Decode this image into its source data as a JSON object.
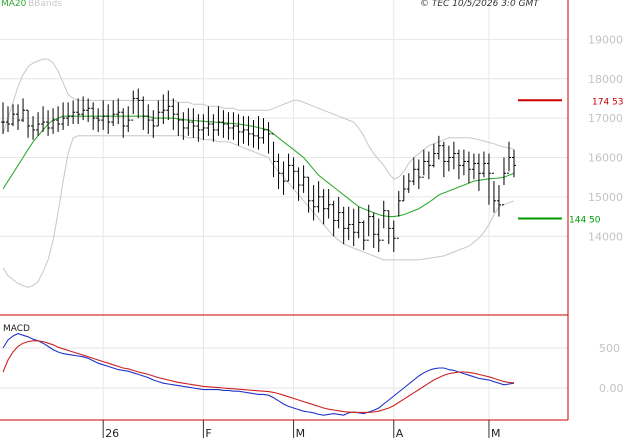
{
  "header": {
    "ma_label": "MA20",
    "bb_label": "BBands",
    "copyright": "© TEC 10/5/2026 3:0 GMT"
  },
  "macd_label": "MACD",
  "colors": {
    "price_bar": "#000000",
    "ma": "#33aa33",
    "bands": "#c8c8c8",
    "resistance": "#cc0000",
    "support": "#009900",
    "macd_line": "#2233cc",
    "signal_line": "#cc2222",
    "grid": "#e6e6e6",
    "axis": "#cc0000"
  },
  "chart_data": [
    {
      "type": "ohlc",
      "title": "",
      "y_ticks": [
        "19000",
        "18000",
        "17000",
        "16000",
        "15000",
        "14000"
      ],
      "ylim": [
        12000,
        20000
      ],
      "x_ticks": [
        "26",
        "F",
        "M",
        "A",
        "M"
      ],
      "resistance": {
        "value": 17453,
        "label": "174 53"
      },
      "support": {
        "value": 14450,
        "label": "144 50"
      },
      "close": [
        16900,
        16850,
        17100,
        16950,
        17200,
        16800,
        16700,
        16850,
        16900,
        16750,
        16950,
        16850,
        17000,
        17050,
        17150,
        17100,
        17200,
        17250,
        17000,
        16950,
        17050,
        16900,
        17100,
        17150,
        16800,
        16950,
        17500,
        17450,
        17050,
        16950,
        16800,
        17150,
        17200,
        17300,
        17100,
        16950,
        16750,
        16900,
        16800,
        16700,
        16750,
        16850,
        16700,
        16900,
        16850,
        16750,
        16800,
        16650,
        16700,
        16600,
        16550,
        16500,
        16700,
        16600,
        15900,
        15600,
        15400,
        15800,
        15650,
        15300,
        15500,
        14900,
        14750,
        15000,
        14700,
        14800,
        14400,
        14600,
        14200,
        14300,
        14100,
        14350,
        13900,
        14500,
        14050,
        13900,
        14650,
        14200,
        13950,
        14900,
        15200,
        15400,
        15700,
        15500,
        15900,
        15800,
        16100,
        16300,
        15900,
        16000,
        16100,
        15800,
        15900,
        15700,
        15850,
        15600,
        15850,
        15600,
        14900,
        14800,
        15600,
        16000,
        15800
      ],
      "high": [
        17400,
        17300,
        17350,
        17350,
        17500,
        17200,
        17050,
        17150,
        17300,
        17200,
        17250,
        17300,
        17400,
        17400,
        17450,
        17500,
        17550,
        17500,
        17400,
        17250,
        17450,
        17350,
        17450,
        17500,
        17250,
        17300,
        17700,
        17750,
        17550,
        17350,
        17200,
        17450,
        17600,
        17700,
        17500,
        17400,
        17150,
        17250,
        17250,
        17100,
        17100,
        17300,
        17100,
        17300,
        17200,
        17150,
        17150,
        17100,
        17050,
        17050,
        16950,
        17050,
        17000,
        16900,
        16400,
        16100,
        15900,
        16100,
        16000,
        15750,
        15800,
        15500,
        15300,
        15400,
        15200,
        15200,
        14900,
        15000,
        14750,
        14750,
        14700,
        14750,
        14400,
        14800,
        14600,
        14450,
        14900,
        14650,
        14400,
        15150,
        15550,
        15600,
        16000,
        15950,
        16200,
        16150,
        16350,
        16550,
        16400,
        16300,
        16400,
        16200,
        16200,
        16150,
        16100,
        16100,
        16150,
        16100,
        15400,
        15300,
        16000,
        16400,
        16200
      ],
      "low": [
        16600,
        16650,
        16800,
        16700,
        16900,
        16500,
        16450,
        16550,
        16650,
        16550,
        16600,
        16650,
        16700,
        16800,
        16850,
        16850,
        16950,
        16900,
        16700,
        16650,
        16700,
        16600,
        16800,
        16850,
        16500,
        16650,
        17100,
        17000,
        16700,
        16600,
        16500,
        16800,
        16850,
        16950,
        16700,
        16550,
        16450,
        16550,
        16500,
        16400,
        16450,
        16550,
        16400,
        16550,
        16500,
        16450,
        16450,
        16300,
        16350,
        16300,
        16250,
        16200,
        16350,
        16100,
        15500,
        15200,
        15050,
        15400,
        15200,
        14900,
        15100,
        14600,
        14400,
        14600,
        14300,
        14450,
        14000,
        14200,
        13800,
        13900,
        13750,
        13950,
        13650,
        14000,
        13700,
        13600,
        14200,
        13800,
        13600,
        14500,
        14900,
        15100,
        15300,
        15200,
        15550,
        15450,
        15750,
        15950,
        15500,
        15650,
        15700,
        15450,
        15550,
        15350,
        15450,
        15150,
        15500,
        14800,
        14600,
        14500,
        15300,
        15650,
        15500
      ],
      "ma": [
        15200,
        15400,
        15600,
        15800,
        16000,
        16200,
        16400,
        16550,
        16700,
        16850,
        16950,
        17000,
        17050,
        17050,
        17050,
        17050,
        17050,
        17050,
        17050,
        17050,
        17050,
        17050,
        17050,
        17050,
        17050,
        17050,
        17050,
        17050,
        17050,
        17050,
        17000,
        17000,
        17000,
        17000,
        17000,
        16980,
        16960,
        16950,
        16940,
        16930,
        16920,
        16910,
        16900,
        16890,
        16880,
        16870,
        16860,
        16850,
        16830,
        16810,
        16790,
        16760,
        16730,
        16700,
        16600,
        16500,
        16400,
        16300,
        16200,
        16100,
        16000,
        15850,
        15700,
        15550,
        15450,
        15350,
        15250,
        15150,
        15050,
        14950,
        14850,
        14750,
        14700,
        14650,
        14600,
        14550,
        14520,
        14500,
        14500,
        14520,
        14550,
        14600,
        14650,
        14700,
        14780,
        14860,
        14950,
        15050,
        15100,
        15150,
        15200,
        15250,
        15300,
        15350,
        15400,
        15420,
        15440,
        15460,
        15470,
        15480,
        15500,
        15550,
        15600
      ],
      "upper": [
        16600,
        17000,
        17400,
        17800,
        18100,
        18300,
        18400,
        18450,
        18500,
        18500,
        18400,
        18200,
        17900,
        17600,
        17500,
        17450,
        17450,
        17450,
        17450,
        17450,
        17450,
        17450,
        17450,
        17450,
        17450,
        17450,
        17450,
        17450,
        17450,
        17450,
        17450,
        17450,
        17450,
        17450,
        17450,
        17400,
        17400,
        17400,
        17350,
        17350,
        17350,
        17300,
        17300,
        17300,
        17250,
        17250,
        17250,
        17200,
        17200,
        17200,
        17200,
        17200,
        17200,
        17200,
        17250,
        17300,
        17350,
        17400,
        17450,
        17450,
        17400,
        17350,
        17300,
        17250,
        17200,
        17150,
        17100,
        17050,
        17000,
        16950,
        16900,
        16750,
        16550,
        16300,
        16100,
        15950,
        15800,
        15600,
        15450,
        15500,
        15650,
        15850,
        16000,
        16100,
        16200,
        16300,
        16350,
        16400,
        16450,
        16500,
        16500,
        16500,
        16500,
        16500,
        16480,
        16450,
        16420,
        16380,
        16350,
        16300,
        16270,
        16240,
        16210
      ],
      "lower": [
        13200,
        13000,
        12900,
        12800,
        12750,
        12700,
        12750,
        12850,
        13100,
        13400,
        13900,
        14600,
        15400,
        16100,
        16500,
        16550,
        16550,
        16550,
        16550,
        16550,
        16550,
        16550,
        16550,
        16550,
        16550,
        16550,
        16550,
        16550,
        16550,
        16550,
        16550,
        16550,
        16550,
        16550,
        16550,
        16550,
        16550,
        16500,
        16500,
        16500,
        16450,
        16450,
        16450,
        16400,
        16400,
        16400,
        16350,
        16300,
        16250,
        16200,
        16150,
        16100,
        16050,
        16000,
        15800,
        15650,
        15500,
        15350,
        15200,
        15050,
        14900,
        14750,
        14600,
        14450,
        14300,
        14150,
        14000,
        13900,
        13800,
        13750,
        13700,
        13650,
        13600,
        13550,
        13500,
        13450,
        13400,
        13400,
        13400,
        13400,
        13400,
        13400,
        13400,
        13400,
        13420,
        13440,
        13460,
        13480,
        13500,
        13550,
        13600,
        13650,
        13700,
        13750,
        13850,
        13950,
        14100,
        14300,
        14550,
        14750,
        14800,
        14850,
        14900
      ]
    },
    {
      "type": "line",
      "title": "",
      "y_ticks": [
        "500",
        "0.00"
      ],
      "ylim": [
        -400,
        900
      ],
      "series": [
        {
          "values": [
            500,
            600,
            650,
            680,
            660,
            640,
            610,
            590,
            560,
            520,
            480,
            450,
            430,
            420,
            410,
            400,
            390,
            370,
            340,
            310,
            290,
            270,
            250,
            230,
            220,
            210,
            190,
            170,
            150,
            130,
            100,
            80,
            60,
            50,
            40,
            30,
            20,
            10,
            0,
            -10,
            -20,
            -20,
            -20,
            -20,
            -30,
            -30,
            -40,
            -40,
            -50,
            -60,
            -70,
            -80,
            -80,
            -90,
            -120,
            -160,
            -200,
            -230,
            -250,
            -270,
            -290,
            -300,
            -310,
            -330,
            -340,
            -330,
            -320,
            -330,
            -340,
            -310,
            -300,
            -310,
            -320,
            -300,
            -280,
            -250,
            -200,
            -150,
            -100,
            -50,
            0,
            50,
            100,
            150,
            190,
            220,
            240,
            250,
            250,
            230,
            220,
            200,
            180,
            160,
            140,
            120,
            110,
            100,
            80,
            60,
            40,
            50,
            60
          ]
        },
        {
          "values": [
            200,
            350,
            450,
            520,
            560,
            580,
            590,
            590,
            580,
            560,
            540,
            510,
            490,
            470,
            450,
            430,
            410,
            390,
            370,
            350,
            330,
            310,
            290,
            270,
            250,
            240,
            220,
            200,
            185,
            170,
            150,
            130,
            115,
            100,
            85,
            70,
            60,
            50,
            40,
            30,
            20,
            15,
            10,
            5,
            0,
            -5,
            -10,
            -15,
            -20,
            -25,
            -30,
            -35,
            -40,
            -45,
            -55,
            -70,
            -90,
            -110,
            -130,
            -150,
            -170,
            -190,
            -210,
            -230,
            -250,
            -265,
            -275,
            -285,
            -295,
            -300,
            -305,
            -305,
            -305,
            -305,
            -300,
            -290,
            -270,
            -250,
            -220,
            -180,
            -140,
            -100,
            -60,
            -20,
            20,
            60,
            100,
            130,
            160,
            180,
            190,
            200,
            200,
            195,
            185,
            170,
            155,
            140,
            120,
            100,
            80,
            70,
            65
          ]
        }
      ]
    }
  ]
}
